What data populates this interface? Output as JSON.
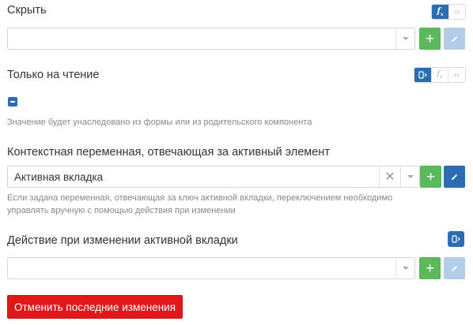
{
  "hide": {
    "label": "Скрыть",
    "modes": [
      "fx-icon",
      "code-icon"
    ],
    "value": ""
  },
  "readonly": {
    "label": "Только на чтение",
    "modes": [
      "toggle-icon",
      "fx-icon",
      "code-icon"
    ],
    "checkbox_state": "indeterminate",
    "hint": "Значение будет унаследовано из формы или из родительского компонента"
  },
  "context_var": {
    "label": "Контекстная переменная, отвечающая за активный элемент",
    "value": "Активная вкладка",
    "hint_line1": "Если задана переменная, отвечающая за ключ активной вкладки, переключением необходимо",
    "hint_line2": "управлять вручную с помощью действия при изменении"
  },
  "on_change": {
    "label": "Действие при изменении активной вкладки",
    "modes": [
      "toggle-icon"
    ],
    "value": ""
  },
  "actions": {
    "revert_label": "Отменить последние изменения"
  },
  "colors": {
    "primary": "#2b6cb3",
    "success": "#5cb85c",
    "danger": "#e0181b",
    "disabled": "#b3cde8"
  }
}
